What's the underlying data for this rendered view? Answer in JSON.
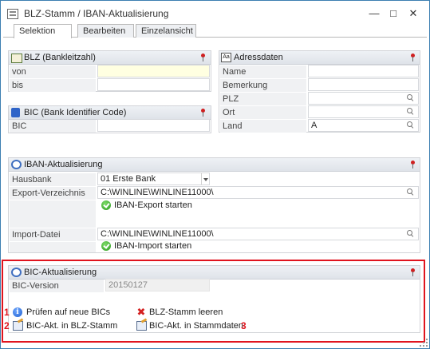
{
  "window": {
    "title": "BLZ-Stamm / IBAN-Aktualisierung",
    "minimize_glyph": "—",
    "maximize_glyph": "□",
    "close_glyph": "✕"
  },
  "tabs": [
    {
      "label": "Selektion",
      "active": true
    },
    {
      "label": "Bearbeiten",
      "active": false
    },
    {
      "label": "Einzelansicht",
      "active": false
    }
  ],
  "blz_group": {
    "title": "BLZ (Bankleitzahl)",
    "von_label": "von",
    "von_value": "",
    "bis_label": "bis",
    "bis_value": ""
  },
  "bic_group": {
    "title": "BIC (Bank Identifier Code)",
    "bic_label": "BIC",
    "bic_value": ""
  },
  "adress_group": {
    "title": "Adressdaten",
    "name_label": "Name",
    "name_value": "",
    "bemerkung_label": "Bemerkung",
    "bemerkung_value": "",
    "plz_label": "PLZ",
    "plz_value": "",
    "ort_label": "Ort",
    "ort_value": "",
    "land_label": "Land",
    "land_value": "A"
  },
  "iban_group": {
    "title": "IBAN-Aktualisierung",
    "hausbank_label": "Hausbank",
    "hausbank_value": "01   Erste Bank",
    "export_label": "Export-Verzeichnis",
    "export_value": "C:\\WINLINE\\WINLINE11000\\",
    "export_action": "IBAN-Export starten",
    "import_label": "Import-Datei",
    "import_value": "C:\\WINLINE\\WINLINE11000\\",
    "import_action": "IBAN-Import starten"
  },
  "bic_akt_group": {
    "title": "BIC-Aktualisierung",
    "version_label": "BIC-Version",
    "version_value": "20150127",
    "action_check": "Prüfen auf neue BICs",
    "action_clear": "BLZ-Stamm leeren",
    "action_blz": "BIC-Akt. in BLZ-Stamm",
    "action_stamm": "BIC-Akt. in Stammdaten",
    "marker_1": "1",
    "marker_2": "2",
    "marker_3": "3"
  },
  "colors": {
    "highlight": "#e0141e",
    "accent": "#3c7fb1"
  }
}
